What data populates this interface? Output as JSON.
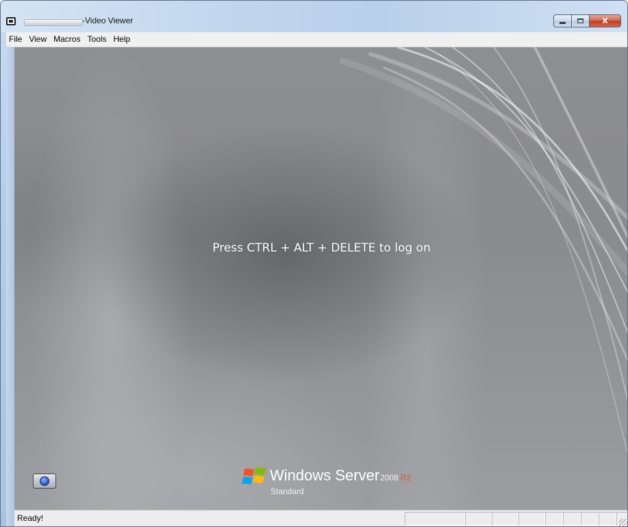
{
  "window": {
    "title": "-Video Viewer",
    "title_redacted": true,
    "caption_buttons": {
      "minimize": "minimize",
      "maximize": "maximize",
      "close": "X"
    }
  },
  "menu": {
    "items": [
      {
        "label": "File"
      },
      {
        "label": "View"
      },
      {
        "label": "Macros"
      },
      {
        "label": "Tools"
      },
      {
        "label": "Help"
      }
    ]
  },
  "viewer": {
    "message": "Press CTRL + ALT + DELETE to log on",
    "accessibility_icon": "ease-of-access-icon",
    "brand": {
      "product": "Windows Server",
      "year": "2008",
      "release": "R2",
      "edition": "Standard",
      "release_color": "#e2582a"
    }
  },
  "status": {
    "text": "Ready!",
    "pane_count": 9
  },
  "colors": {
    "frame": "#b8d0ea",
    "close_button": "#c0391c",
    "screen_background": "#8d8e92"
  }
}
